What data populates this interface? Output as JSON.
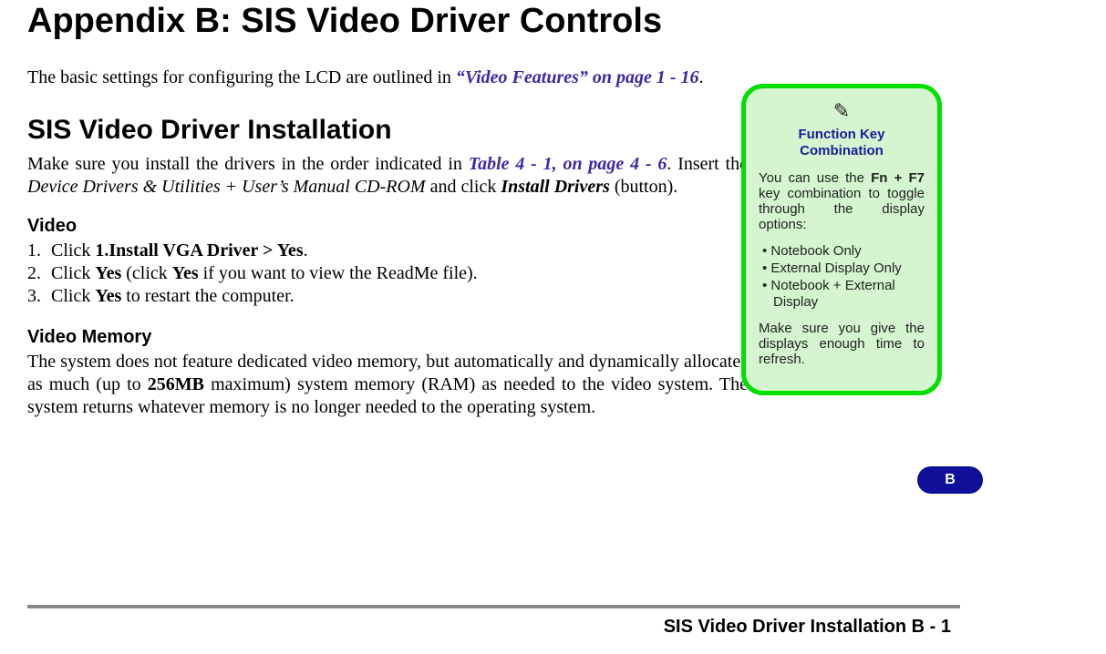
{
  "title": "Appendix B: SIS Video Driver Controls",
  "intro_prefix": "The basic settings for configuring the LCD are outlined in ",
  "intro_xref": "“Video Features” on page 1 - 16",
  "intro_suffix": ".",
  "section1_heading": "SIS Video Driver Installation",
  "section1_para_pre": "Make sure you install the drivers in the order indicated in ",
  "section1_xref": "Table 4 - 1, on page 4 - 6",
  "section1_para_post1": ". Insert the ",
  "section1_italic": "Device Drivers & Utilities + User’s Manual CD-ROM",
  "section1_para_post2": " and click ",
  "section1_bold": "Install Drivers",
  "section1_para_post3": " (button).",
  "video_heading": "Video",
  "steps": [
    {
      "n": "1.",
      "pre": "Click ",
      "bold": "1.Install VGA Driver > Yes",
      "post": "."
    },
    {
      "n": "2.",
      "pre": "Click ",
      "bold": "Yes",
      "mid": " (click ",
      "bold2": "Yes",
      "post": " if you want to view the ReadMe file)."
    },
    {
      "n": "3.",
      "pre": "Click ",
      "bold": "Yes",
      "post": " to restart the computer."
    }
  ],
  "vmem_heading": "Video Memory",
  "vmem_para_pre": "The system does not feature dedicated video memory, but automatically and dynamically allocates as much (up to ",
  "vmem_bold": "256MB",
  "vmem_para_post": " maximum) system memory (RAM) as needed to the video system. The system returns whatever memory is no longer needed to the operating system.",
  "note": {
    "icon": "✎",
    "title": "Function Key Combination",
    "p1_pre": "You can use the ",
    "p1_bold": "Fn + F7",
    "p1_post": " key combination to toggle through the display options:",
    "items": [
      "Notebook Only",
      "External Display Only",
      "Notebook + External Display"
    ],
    "p2": "Make sure you give the displays enough time to refresh."
  },
  "tab_label": "B",
  "footer": "SIS Video Driver Installation  B  -  1"
}
